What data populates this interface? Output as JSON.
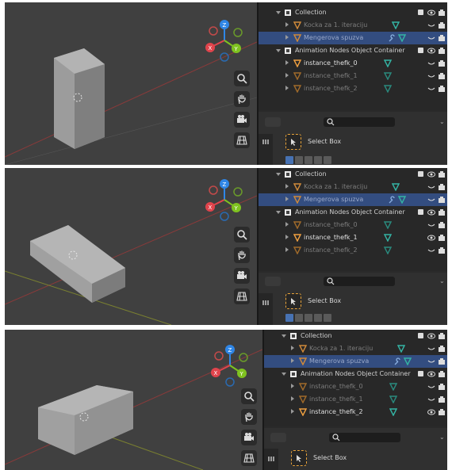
{
  "outliner": {
    "collection_label": "Collection",
    "item_kocka": "Kocka za 1. iteraciju",
    "item_mengerova": "Mengerova spuzva",
    "container_label": "Animation Nodes Object Container",
    "instances": [
      "instance_thefk_0",
      "instance_thefk_1",
      "instance_thefk_2"
    ]
  },
  "panels": [
    {
      "active_instance": 0
    },
    {
      "active_instance": 1
    },
    {
      "active_instance": 2
    }
  ],
  "toolbar": {
    "tool_label": "Select Box"
  },
  "colors": {
    "axis_x": "#e0444c",
    "axis_y": "#7fc220",
    "axis_z": "#2f86e6",
    "highlight_row": "#334d80",
    "selected_orange": "#f0a040",
    "mesh_teal": "#34b4a4"
  },
  "viewport_tools": [
    "zoom-icon",
    "hand-pan-icon",
    "camera-icon",
    "grid-perspective-icon"
  ]
}
